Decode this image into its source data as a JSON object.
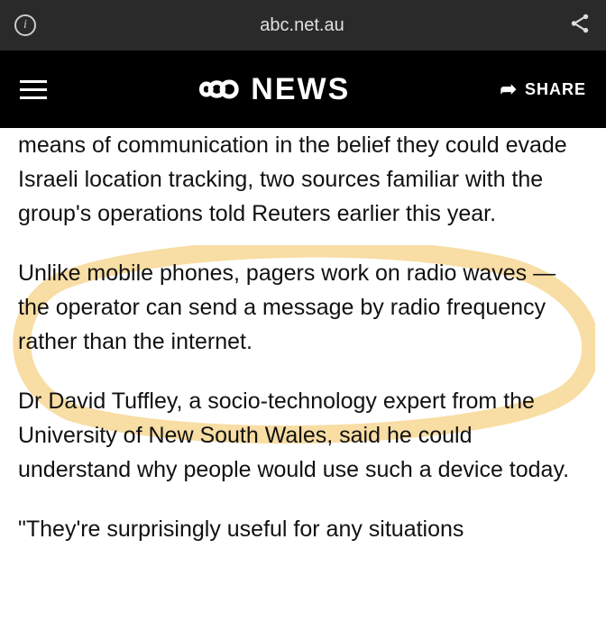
{
  "browser": {
    "url": "abc.net.au"
  },
  "header": {
    "brand_text": "NEWS",
    "share_label": "SHARE"
  },
  "article": {
    "p1": "Hezbollah fighters have been using pagers as a low-tech means of communication in the belief they could evade Israeli location tracking, two sources familiar with the group's operations told Reuters earlier this year.",
    "p2": "Unlike mobile phones, pagers work on radio waves — the operator can send a message by radio frequency rather than the internet.",
    "p3": "Dr David Tuffley, a socio-technology expert from the University of New South Wales, said he could understand why people would use such a device today.",
    "p4": "\"They're surprisingly useful for any situations"
  }
}
